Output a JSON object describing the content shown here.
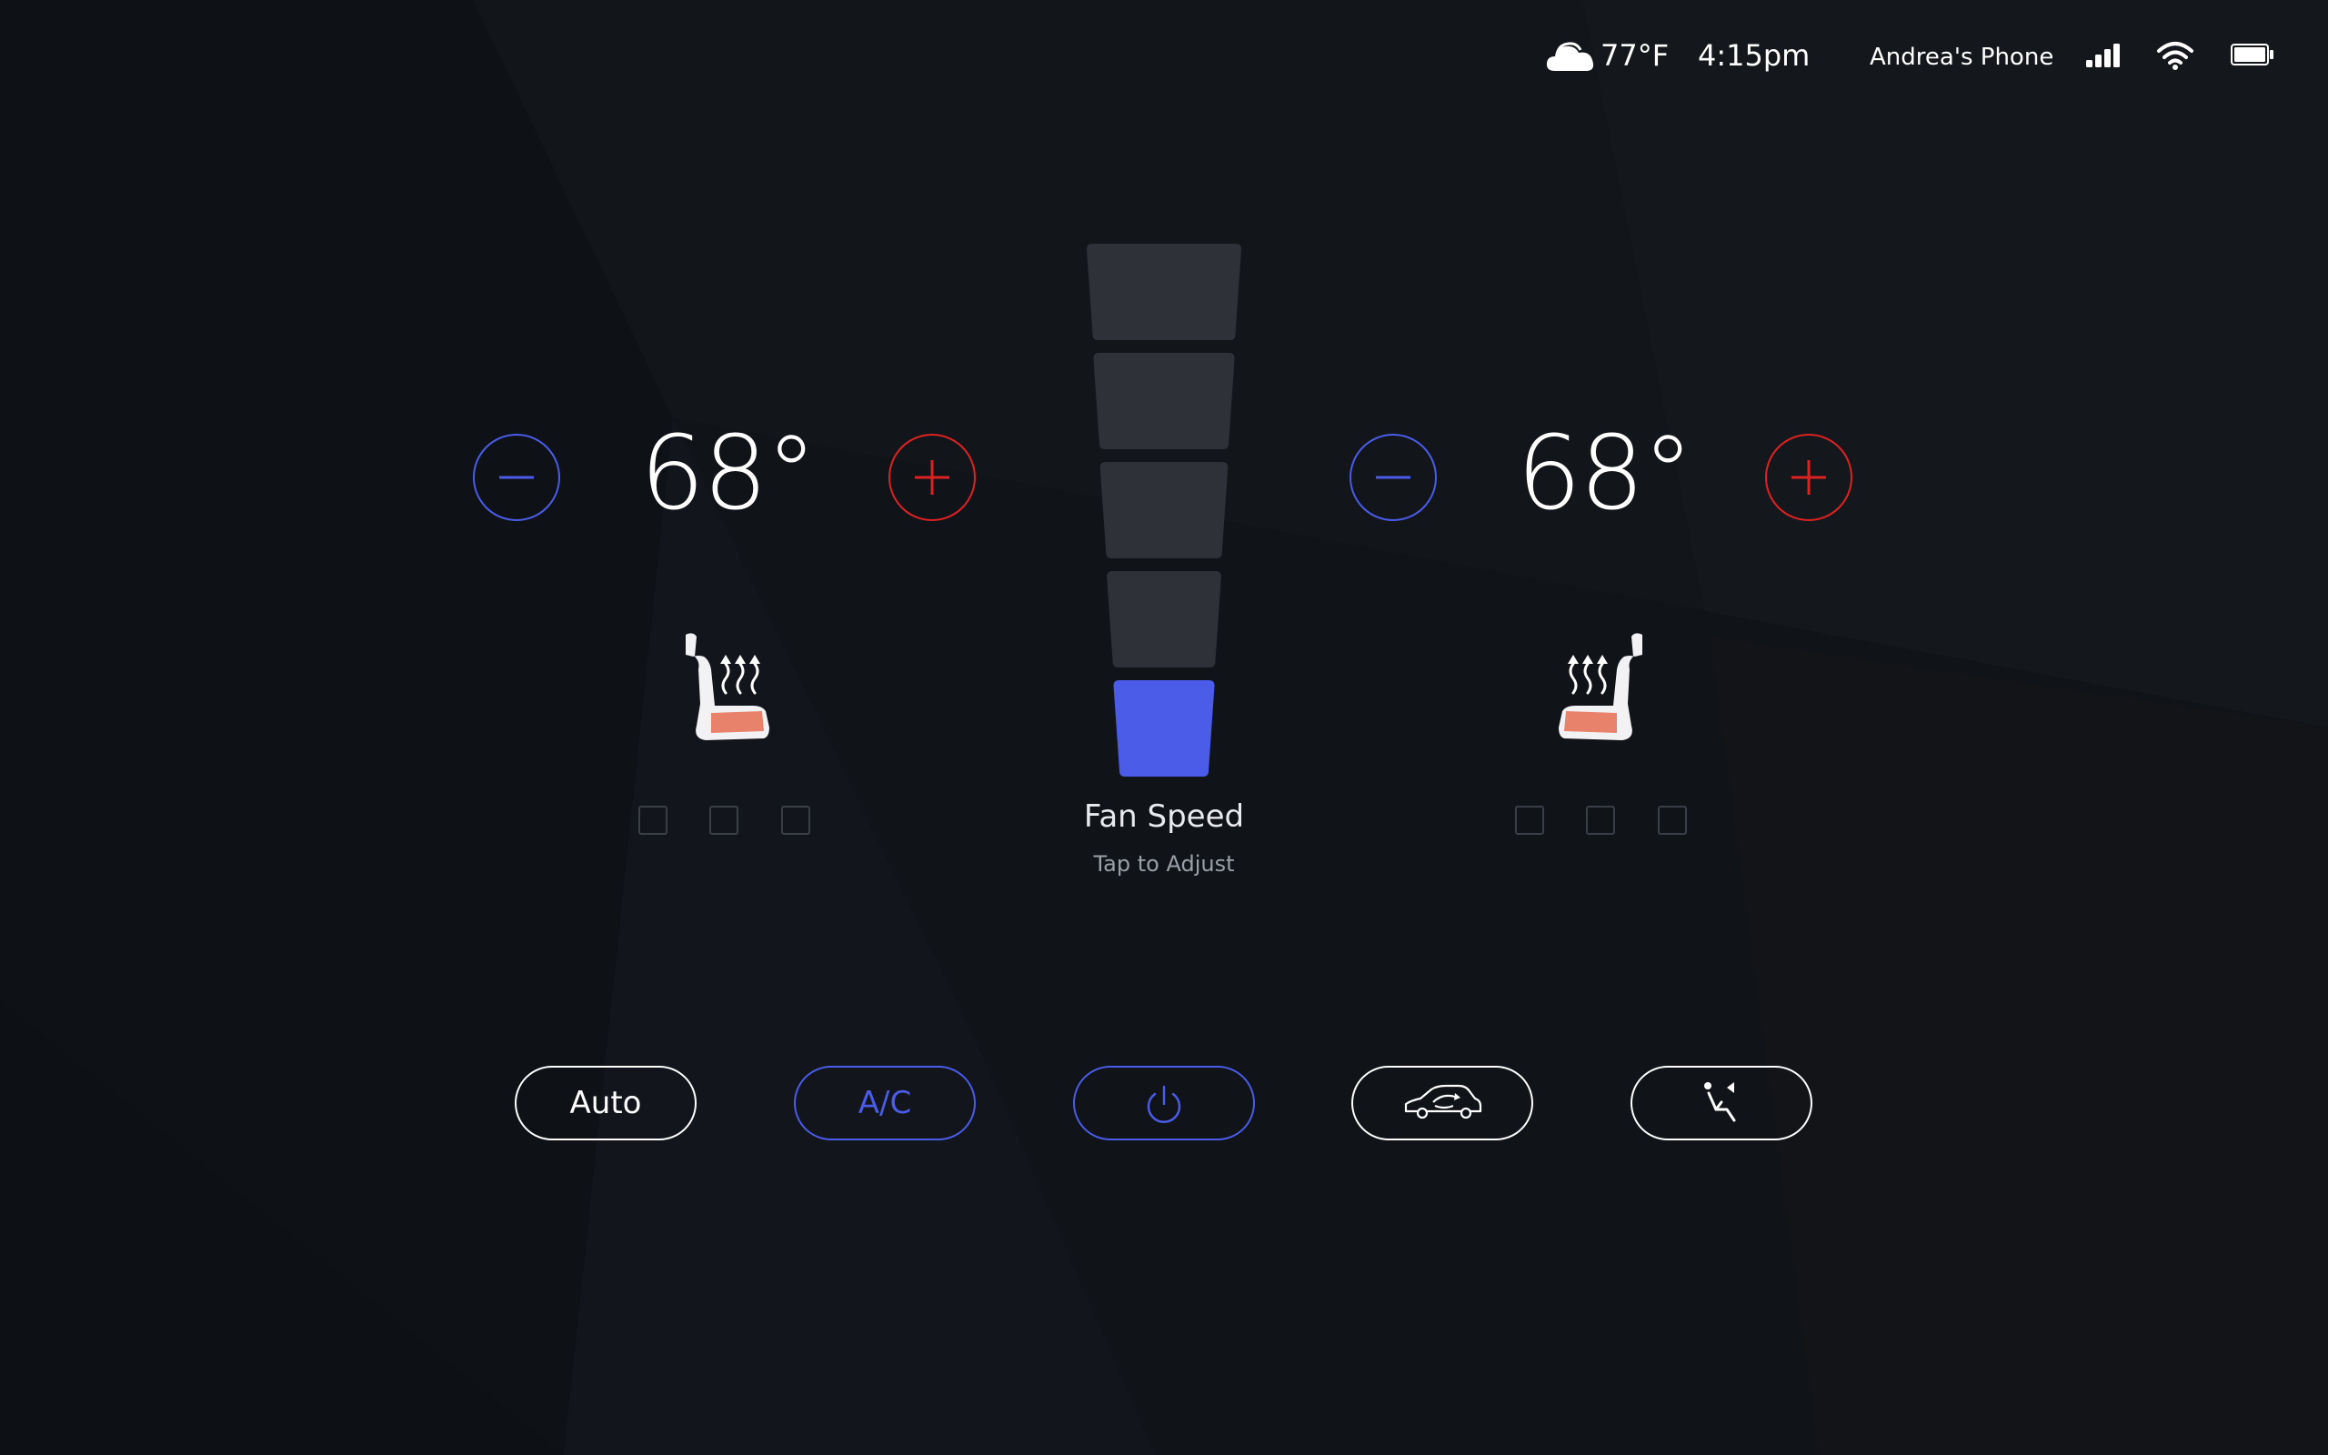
{
  "status_bar": {
    "weather_icon": "cloud-icon",
    "temperature": "77°F",
    "time": "4:15pm",
    "device": "Andrea's Phone",
    "signal_icon": "cellular-signal-icon",
    "wifi_icon": "wifi-icon",
    "battery_icon": "battery-icon"
  },
  "climate": {
    "driver": {
      "temperature": "68°",
      "decrease_icon": "minus-icon",
      "increase_icon": "plus-icon",
      "seat_icon": "heated-seat-icon",
      "seat_heat_levels": [
        false,
        false,
        false
      ]
    },
    "passenger": {
      "temperature": "68°",
      "decrease_icon": "minus-icon",
      "increase_icon": "plus-icon",
      "seat_icon": "heated-seat-icon",
      "seat_heat_levels": [
        false,
        false,
        false
      ]
    },
    "fan": {
      "title": "Fan Speed",
      "subtitle": "Tap to Adjust",
      "levels": 5,
      "active_level": 1
    }
  },
  "controls": {
    "auto_label": "Auto",
    "ac_label": "A/C",
    "power_icon": "power-icon",
    "recirculate_icon": "car-recirculation-icon",
    "airflow_icon": "airflow-direction-icon"
  },
  "colors": {
    "background": "#0b1016",
    "accent_blue": "#4a5ce8",
    "accent_red": "#dd2222",
    "seat_heat": "#e8826a",
    "fan_inactive": "#2e3238",
    "seat_level_border": "#3a3f47"
  }
}
